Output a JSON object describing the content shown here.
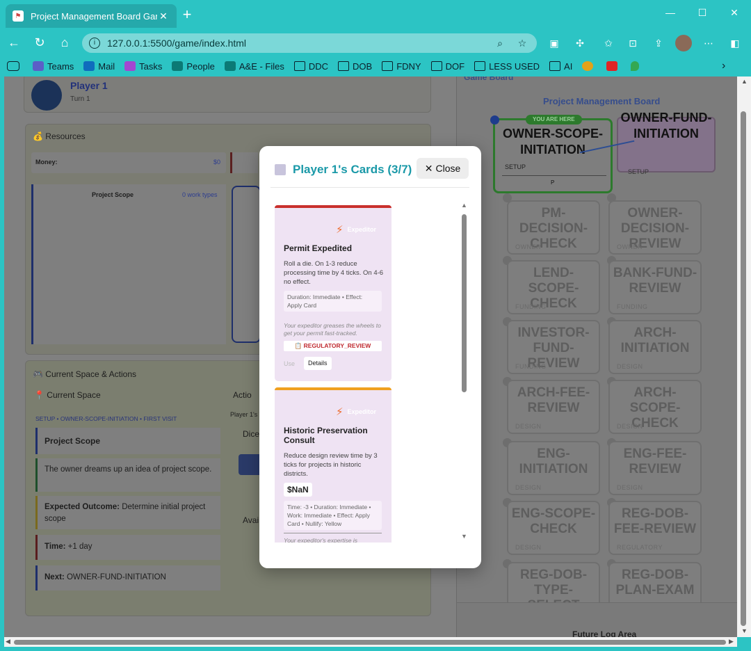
{
  "browser": {
    "tab_title": "Project Management Board Game",
    "url": "127.0.0.1:5500/game/index.html",
    "bookmarks": [
      "Teams",
      "Mail",
      "Tasks",
      "People",
      "A&E - Files",
      "DDC",
      "DOB",
      "FDNY",
      "DOF",
      "LESS USED",
      "AI"
    ]
  },
  "player_panel": {
    "name": "Player 1",
    "turn": "Turn 1"
  },
  "resources": {
    "title": "Resources",
    "money_label": "Money:",
    "money_value": "$0",
    "scope_label": "Project Scope",
    "scope_value": "0 work types"
  },
  "current_space": {
    "section_title": "Current Space & Actions",
    "heading": "Current Space",
    "breadcrumb": "SETUP • OWNER-SCOPE-INITIATION • FIRST VISIT",
    "items": [
      {
        "label": "Project Scope",
        "bold": true
      },
      {
        "label": "The owner dreams up an idea of project scope."
      },
      {
        "bold_label": "Expected Outcome:",
        "label": "Determine initial project scope"
      },
      {
        "bold_label": "Time:",
        "label": "+1 day"
      },
      {
        "bold_label": "Next:",
        "label": "OWNER-FUND-INITIATION"
      }
    ],
    "actions_heading": "Actio",
    "actions_sub": "Player 1's T",
    "dice_label": "Dice",
    "available_label": "Avai"
  },
  "board": {
    "header": "Game Board",
    "title": "Project Management Board",
    "you_are_here": "YOU ARE HERE",
    "spaces": [
      {
        "name": "OWNER-SCOPE-INITIATION",
        "phase": "SETUP"
      },
      {
        "name": "OWNER-FUND-INITIATION",
        "phase": "SETUP"
      },
      {
        "name": "PM-DECISION-CHECK",
        "phase": "OWNER"
      },
      {
        "name": "OWNER-DECISION-REVIEW",
        "phase": "OWNER"
      },
      {
        "name": "LEND-SCOPE-CHECK",
        "phase": "FUNDING"
      },
      {
        "name": "BANK-FUND-REVIEW",
        "phase": "FUNDING"
      },
      {
        "name": "INVESTOR-FUND-REVIEW",
        "phase": "FUNDING"
      },
      {
        "name": "ARCH-INITIATION",
        "phase": "DESIGN"
      },
      {
        "name": "ARCH-FEE-REVIEW",
        "phase": "DESIGN"
      },
      {
        "name": "ARCH-SCOPE-CHECK",
        "phase": "DESIGN"
      },
      {
        "name": "ENG-INITIATION",
        "phase": "DESIGN"
      },
      {
        "name": "ENG-FEE-REVIEW",
        "phase": "DESIGN"
      },
      {
        "name": "ENG-SCOPE-CHECK",
        "phase": "DESIGN"
      },
      {
        "name": "REG-DOB-FEE-REVIEW",
        "phase": "REGULATORY"
      },
      {
        "name": "REG-DOB-TYPE-SELECT",
        "phase": ""
      },
      {
        "name": "REG-DOB-PLAN-EXAM",
        "phase": ""
      }
    ],
    "future_log": "Future Log Area"
  },
  "modal": {
    "title": "Player 1's Cards (3/7)",
    "close_label": "Close",
    "cards": [
      {
        "type": "Expeditor",
        "name": "Permit Expedited",
        "description": "Roll a die. On 1-3 reduce processing time by 4 ticks. On 4-6 no effect.",
        "meta": "Duration: Immediate • Effect: Apply Card",
        "flavor": "Your expeditor greases the wheels to get your permit fast-tracked.",
        "tag": "REGULATORY_REVIEW",
        "use_label": "Use",
        "details_label": "Details",
        "color": "#c9302c"
      },
      {
        "type": "Expeditor",
        "name": "Historic Preservation Consult",
        "description": "Reduce design review time by 3 ticks for projects in historic districts.",
        "price": "$NaN",
        "meta": "Time: -3 • Duration: Immediate • Work: Immediate • Effect: Apply Card • Nullify: Yellow",
        "flavor": "Your expeditor's expertise is",
        "color": "#f0a020"
      }
    ]
  }
}
